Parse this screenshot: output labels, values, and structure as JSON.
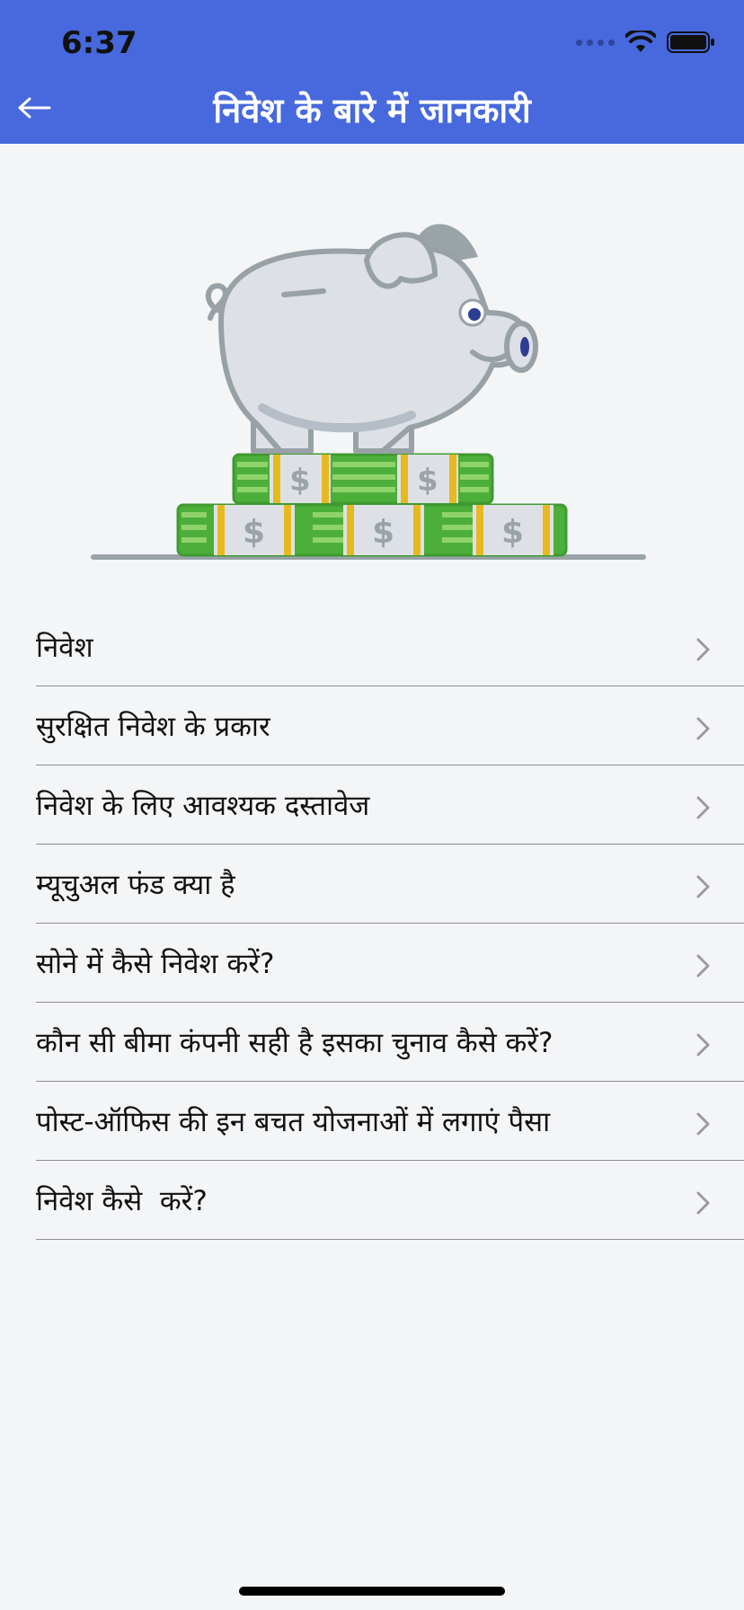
{
  "status_bar": {
    "time": "6:37"
  },
  "header": {
    "title": "निवेश के बारे में जानकारी",
    "back_icon": "arrow-left-icon"
  },
  "hero": {
    "image": "piggy-bank-with-money-stacks",
    "currency_symbol": "$"
  },
  "menu": {
    "items": [
      {
        "label": "निवेश"
      },
      {
        "label": "सुरक्षित निवेश के प्रकार"
      },
      {
        "label": "निवेश के लिए आवश्यक दस्तावेज"
      },
      {
        "label": "म्यूचुअल फंड क्या है"
      },
      {
        "label": "सोने में कैसे निवेश करें?"
      },
      {
        "label": "कौन सी बीमा कंपनी सही है इसका चुनाव कैसे करें?"
      },
      {
        "label": "पोस्ट-ऑफिस की इन बचत योजनाओं में लगाएं पैसा"
      },
      {
        "label": "निवेश कैसे  करें?"
      }
    ]
  },
  "colors": {
    "header_bg": "#4769dd",
    "page_bg": "#f4f5f7",
    "accent_green": "#4caf3a"
  }
}
